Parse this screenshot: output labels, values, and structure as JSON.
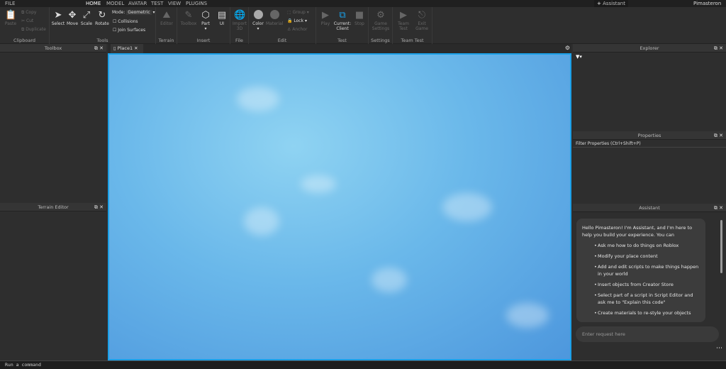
{
  "menu": {
    "items": [
      "FILE",
      "HOME",
      "MODEL",
      "AVATAR",
      "TEST",
      "VIEW",
      "PLUGINS"
    ],
    "assistant_tab": "Assistant",
    "user": "Pimasteron"
  },
  "ribbon": {
    "clipboard": {
      "label": "Clipboard",
      "paste": "Paste",
      "copy": "Copy",
      "cut": "Cut",
      "duplicate": "Duplicate"
    },
    "tools": {
      "label": "Tools",
      "select": "Select",
      "move": "Move",
      "scale": "Scale",
      "rotate": "Rotate",
      "mode_label": "Mode:",
      "mode_value": "Geometric",
      "collisions": "Collisions",
      "join_surfaces": "Join Surfaces"
    },
    "terrain": {
      "label": "Terrain",
      "editor": "Editor"
    },
    "insert": {
      "label": "Insert",
      "toolbox": "Toolbox",
      "part": "Part",
      "ui": "UI"
    },
    "file": {
      "label": "File",
      "import3d": "Import 3D"
    },
    "edit": {
      "label": "Edit",
      "color": "Color",
      "material": "Material",
      "group": "Group",
      "lock": "Lock",
      "anchor": "Anchor"
    },
    "test": {
      "label": "Test",
      "play": "Play",
      "current_client": "Current: Client",
      "stop": "Stop"
    },
    "settings": {
      "label": "Settings",
      "game_settings": "Game Settings"
    },
    "team_test": {
      "label": "Team Test",
      "team_test": "Team Test",
      "exit_game": "Exit Game"
    }
  },
  "panels": {
    "toolbox": "Toolbox",
    "terrain_editor": "Terrain Editor",
    "explorer": "Explorer",
    "properties": "Properties",
    "properties_filter": "Filter Properties (Ctrl+Shift+P)",
    "assistant": "Assistant"
  },
  "doc_tab": "Place1",
  "assistant": {
    "greeting": "Hello Pimasteron! I'm Assistant, and I'm here to help you build your experience. You can",
    "bullets": [
      "Ask me how to do things on Roblox",
      "Modify your place content",
      "Add and edit scripts to make things happen in your world",
      "Insert objects from Creator Store",
      "Select part of a script in Script Editor and ask me to \"Explain this code\"",
      "Create materials to re-style your objects"
    ],
    "input_placeholder": "Enter request here"
  },
  "command_bar": "Run a command"
}
